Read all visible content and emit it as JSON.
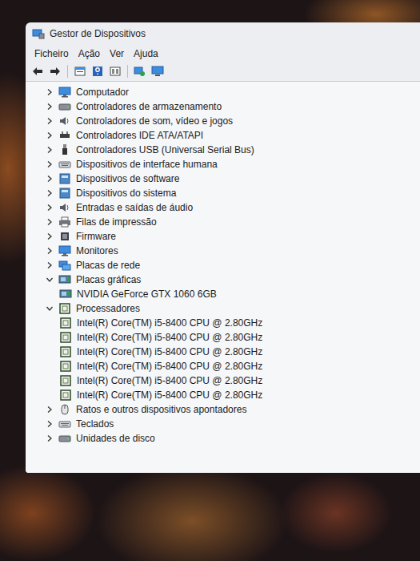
{
  "window": {
    "title": "Gestor de Dispositivos"
  },
  "menu": [
    "Ficheiro",
    "Ação",
    "Ver",
    "Ajuda"
  ],
  "tree": [
    {
      "label": "Computador",
      "expanded": false,
      "children": []
    },
    {
      "label": "Controladores de armazenamento",
      "expanded": false,
      "children": []
    },
    {
      "label": "Controladores de som, vídeo e jogos",
      "expanded": false,
      "children": []
    },
    {
      "label": "Controladores IDE ATA/ATAPI",
      "expanded": false,
      "children": []
    },
    {
      "label": "Controladores USB (Universal Serial Bus)",
      "expanded": false,
      "children": []
    },
    {
      "label": "Dispositivos de interface humana",
      "expanded": false,
      "children": []
    },
    {
      "label": "Dispositivos de software",
      "expanded": false,
      "children": []
    },
    {
      "label": "Dispositivos do sistema",
      "expanded": false,
      "children": []
    },
    {
      "label": "Entradas e saídas de áudio",
      "expanded": false,
      "children": []
    },
    {
      "label": "Filas de impressão",
      "expanded": false,
      "children": []
    },
    {
      "label": "Firmware",
      "expanded": false,
      "children": []
    },
    {
      "label": "Monitores",
      "expanded": false,
      "children": []
    },
    {
      "label": "Placas de rede",
      "expanded": false,
      "children": []
    },
    {
      "label": "Placas gráficas",
      "expanded": true,
      "children": [
        "NVIDIA GeForce GTX 1060 6GB"
      ]
    },
    {
      "label": "Processadores",
      "expanded": true,
      "children": [
        "Intel(R) Core(TM) i5-8400 CPU @ 2.80GHz",
        "Intel(R) Core(TM) i5-8400 CPU @ 2.80GHz",
        "Intel(R) Core(TM) i5-8400 CPU @ 2.80GHz",
        "Intel(R) Core(TM) i5-8400 CPU @ 2.80GHz",
        "Intel(R) Core(TM) i5-8400 CPU @ 2.80GHz",
        "Intel(R) Core(TM) i5-8400 CPU @ 2.80GHz"
      ]
    },
    {
      "label": "Ratos e outros dispositivos apontadores",
      "expanded": false,
      "children": []
    },
    {
      "label": "Teclados",
      "expanded": false,
      "children": []
    },
    {
      "label": "Unidades de disco",
      "expanded": false,
      "children": []
    }
  ]
}
